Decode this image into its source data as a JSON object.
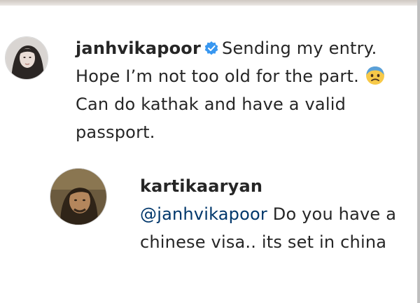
{
  "comments": [
    {
      "username": "janhvikapoor",
      "verified": true,
      "verified_icon": "verified-badge-icon",
      "text_part1": "Sending my entry. Hope I’m not too old for the part.",
      "emoji": "worried-face-icon",
      "text_part2": "Can do kathak and have a valid passport."
    },
    {
      "username": "kartikaaryan",
      "mention": "@janhvikapoor",
      "text": "Do you have a chinese visa.. its set in china"
    }
  ],
  "colors": {
    "text": "#262626",
    "mention": "#00376b",
    "verified": "#3897f0"
  }
}
